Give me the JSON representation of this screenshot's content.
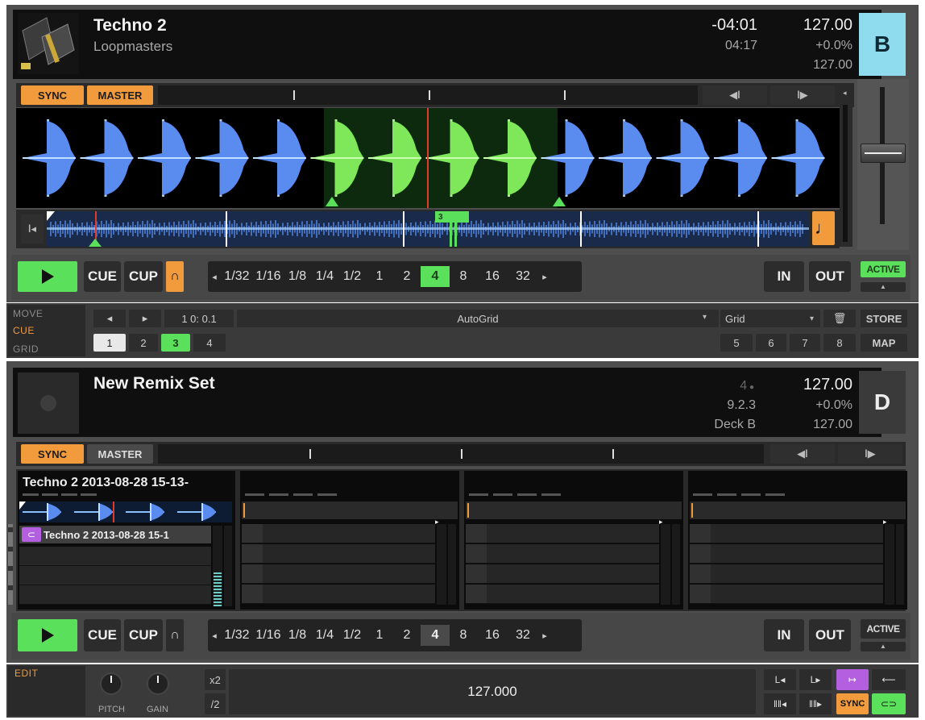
{
  "deck_b": {
    "title": "Techno 2",
    "artist": "Loopmasters",
    "remaining": "-04:01",
    "length": "04:17",
    "bpm": "127.00",
    "tempo_offset": "+0.0%",
    "base_bpm": "127.00",
    "letter": "B",
    "letter_color": "#8edcee",
    "sync_label": "SYNC",
    "master_label": "MASTER",
    "cue_label": "CUE",
    "cup_label": "CUP",
    "in_label": "IN",
    "out_label": "OUT",
    "active_label": "ACTIVE",
    "loop_sizes": [
      "1/32",
      "1/16",
      "1/8",
      "1/4",
      "1/2",
      "1",
      "2",
      "4",
      "8",
      "16",
      "32"
    ],
    "loop_selected": "4",
    "beat_marker": "3"
  },
  "cue_panel": {
    "modes": [
      "MOVE",
      "CUE",
      "GRID"
    ],
    "active_mode": "CUE",
    "position": "1 0: 0.1",
    "cue_name": "AutoGrid",
    "cue_type": "Grid",
    "store_label": "STORE",
    "map_label": "MAP",
    "hotcues_left": [
      "1",
      "2",
      "3",
      "4"
    ],
    "hotcues_right": [
      "5",
      "6",
      "7",
      "8"
    ],
    "hotcue_selected": "3"
  },
  "deck_d": {
    "title": "New Remix Set",
    "slot_count": "4",
    "version": "9.2.3",
    "source": "Deck B",
    "bpm": "127.00",
    "tempo_offset": "+0.0%",
    "base_bpm": "127.00",
    "letter": "D",
    "sync_label": "SYNC",
    "master_label": "MASTER",
    "slot1_title": "Techno 2 2013-08-28 15-13-",
    "slot1_cell": "Techno 2 2013-08-28 15-1",
    "cue_label": "CUE",
    "cup_label": "CUP",
    "in_label": "IN",
    "out_label": "OUT",
    "active_label": "ACTIVE",
    "loop_sizes": [
      "1/32",
      "1/16",
      "1/8",
      "1/4",
      "1/2",
      "1",
      "2",
      "4",
      "8",
      "16",
      "32"
    ],
    "loop_selected": "4"
  },
  "edit_panel": {
    "mode": "EDIT",
    "pitch_label": "PITCH",
    "gain_label": "GAIN",
    "x2_label": "x2",
    "half_label": "/2",
    "bpm_value": "127.000",
    "sync_label": "SYNC"
  }
}
